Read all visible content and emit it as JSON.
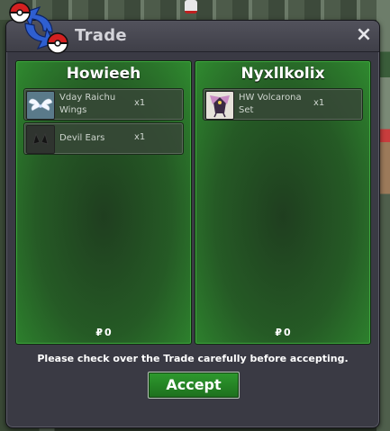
{
  "window": {
    "title": "Trade",
    "close_label": "×"
  },
  "left_panel": {
    "player": "Howieeh",
    "items": [
      {
        "name_line1": "Vday Raichu",
        "name_line2": "Wings",
        "qty": "x1",
        "icon": "white-wings-icon"
      },
      {
        "name_line1": "Devil Ears",
        "name_line2": "",
        "qty": "x1",
        "icon": "devil-ears-icon"
      }
    ],
    "money": "0",
    "currency_symbol": "₽"
  },
  "right_panel": {
    "player": "Nyxllkolix",
    "items": [
      {
        "name_line1": "HW Volcarona",
        "name_line2": "Set",
        "qty": "x1",
        "icon": "volcarona-set-icon"
      }
    ],
    "money": "0",
    "currency_symbol": "₽"
  },
  "footer": {
    "notice": "Please check over the Trade carefully before accepting.",
    "accept_label": "Accept"
  },
  "colors": {
    "panel_green": "#2f8a2f",
    "accept_green": "#2e9a2e",
    "window_bg": "#3a3a44"
  }
}
